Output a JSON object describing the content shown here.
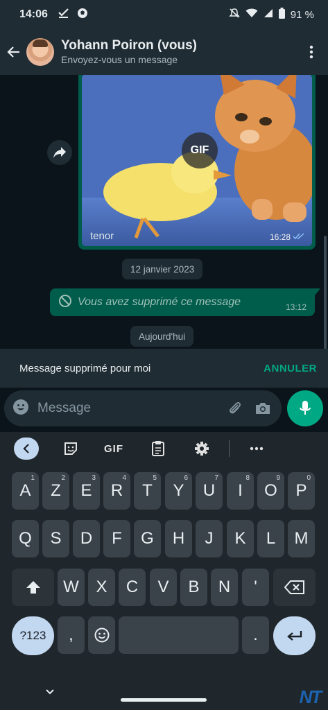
{
  "status_bar": {
    "time": "14:06",
    "battery": "91 %"
  },
  "header": {
    "title": "Yohann Poiron (vous)",
    "subtitle": "Envoyez-vous un message"
  },
  "messages": {
    "gif": {
      "badge": "GIF",
      "provider": "tenor",
      "time": "16:28"
    },
    "date_1": "12 janvier 2023",
    "deleted": {
      "text": "Vous avez supprimé ce message",
      "time": "13:12"
    },
    "date_2": "Aujourd'hui"
  },
  "snackbar": {
    "message": "Message supprimé pour moi",
    "action": "ANNULER"
  },
  "compose": {
    "placeholder": "Message"
  },
  "keyboard": {
    "toolbar": {
      "gif": "GIF"
    },
    "row1": [
      {
        "k": "A",
        "n": "1"
      },
      {
        "k": "Z",
        "n": "2"
      },
      {
        "k": "E",
        "n": "3"
      },
      {
        "k": "R",
        "n": "4"
      },
      {
        "k": "T",
        "n": "5"
      },
      {
        "k": "Y",
        "n": "6"
      },
      {
        "k": "U",
        "n": "7"
      },
      {
        "k": "I",
        "n": "8"
      },
      {
        "k": "O",
        "n": "9"
      },
      {
        "k": "P",
        "n": "0"
      }
    ],
    "row2": [
      "Q",
      "S",
      "D",
      "F",
      "G",
      "H",
      "J",
      "K",
      "L",
      "M"
    ],
    "row3": [
      "W",
      "X",
      "C",
      "V",
      "B",
      "N",
      "'"
    ],
    "row4": {
      "symbols": "?123",
      "comma": ",",
      "period": "."
    }
  },
  "colors": {
    "accent": "#00a884",
    "bubble": "#005c4b",
    "header": "#1f2c34",
    "background": "#0b141a"
  },
  "watermark": "NT"
}
